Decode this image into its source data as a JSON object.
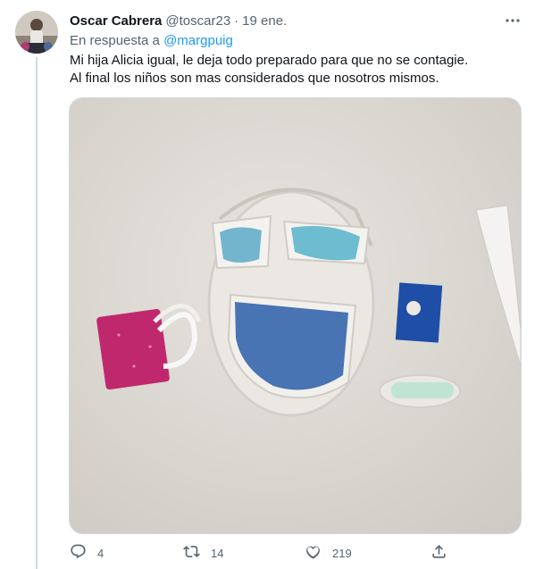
{
  "tweet": {
    "author_name": "Oscar Cabrera",
    "handle": "@toscar23",
    "separator": "·",
    "time": "19 ene.",
    "reply_prefix": "En respuesta a",
    "reply_mention": "@margpuig",
    "text_line1": "Mi hija Alicia igual, le deja todo preparado para que no se contagie.",
    "text_line2": "Al final los niños son mas considerados que nosotros mismos.",
    "more_icon": "more-dots-icon"
  },
  "actions": {
    "reply_count": "4",
    "retweet_count": "14",
    "like_count": "219"
  },
  "colors": {
    "text": "#0f1419",
    "secondary": "#536471",
    "link": "#1d9bf0",
    "border": "#cfd9de"
  }
}
